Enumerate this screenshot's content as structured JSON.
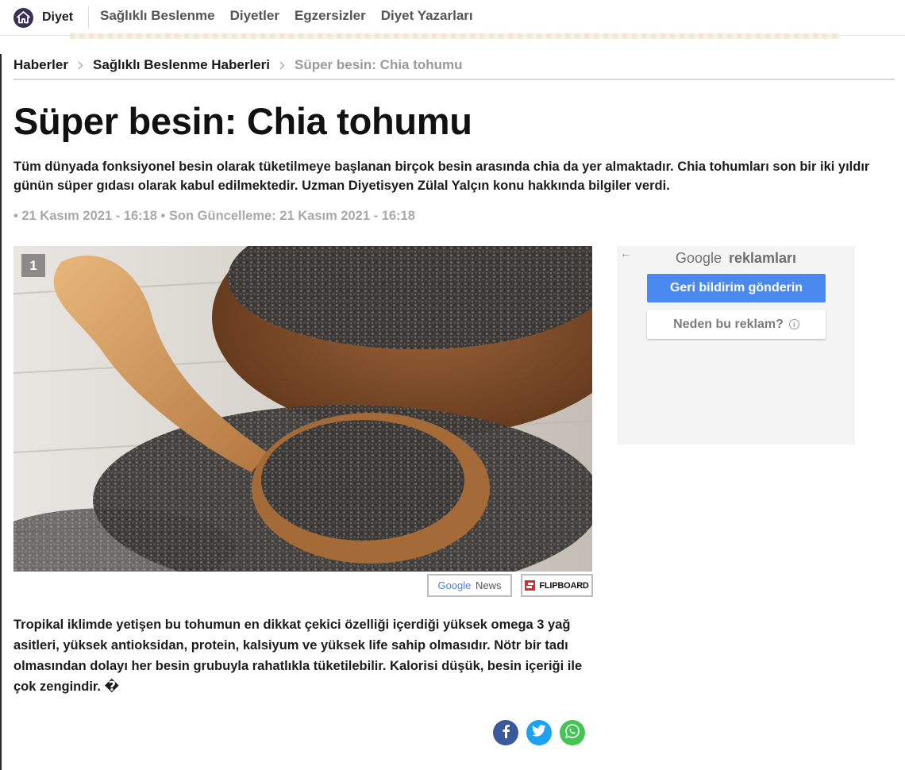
{
  "nav": {
    "brand": "Diyet",
    "items": [
      {
        "label": "Sağlıklı Beslenme"
      },
      {
        "label": "Diyetler"
      },
      {
        "label": "Egzersizler"
      },
      {
        "label": "Diyet Yazarları"
      }
    ]
  },
  "breadcrumb": [
    {
      "label": "Haberler"
    },
    {
      "label": "Sağlıklı Beslenme Haberleri"
    },
    {
      "label": "Süper besin: Chia tohumu"
    }
  ],
  "article": {
    "title": "Süper besin: Chia tohumu",
    "summary": "Tüm dünyada fonksiyonel besin olarak tüketilmeye başlanan birçok besin arasında chia da yer almaktadır. Chia tohumları son bir iki yıldır günün süper gıdası olarak kabul edilmektedir. Uzman Diyetisyen Zülal Yalçın konu hakkında bilgiler verdi.",
    "meta": "• 21 Kasım 2021 - 16:18 • Son Güncelleme: 21 Kasım 2021 - 16:18",
    "image_index": "1",
    "body": "Tropikal iklimde yetişen bu tohumun en dikkat çekici özelliği içerdiği yüksek omega 3 yağ asitleri, yüksek  antioksidan, protein, kalsiyum ve yüksek life sahip olmasıdır. Nötr bir tadı olmasından dolayı her besin grubuyla rahatlıkla tüketilebilir. Kalorisi düşük, besin içeriği ile çok zengindir. �"
  },
  "share": {
    "google_news": {
      "google": "Google",
      "news": "News"
    },
    "flipboard": "FLIPBOARD",
    "icons": [
      "facebook-icon",
      "twitter-icon",
      "whatsapp-icon"
    ]
  },
  "ad": {
    "back": "←",
    "title_brand": "Google",
    "title_suffix": "reklamları",
    "feedback_button": "Geri bildirim gönderin",
    "why_button": "Neden bu reklam?",
    "info_glyph": "i"
  },
  "colors": {
    "brand_icon": "#3a2f55",
    "ad_button": "#4a89f0",
    "facebook": "#3b5998",
    "twitter": "#1da1f2",
    "whatsapp": "#43c553"
  }
}
